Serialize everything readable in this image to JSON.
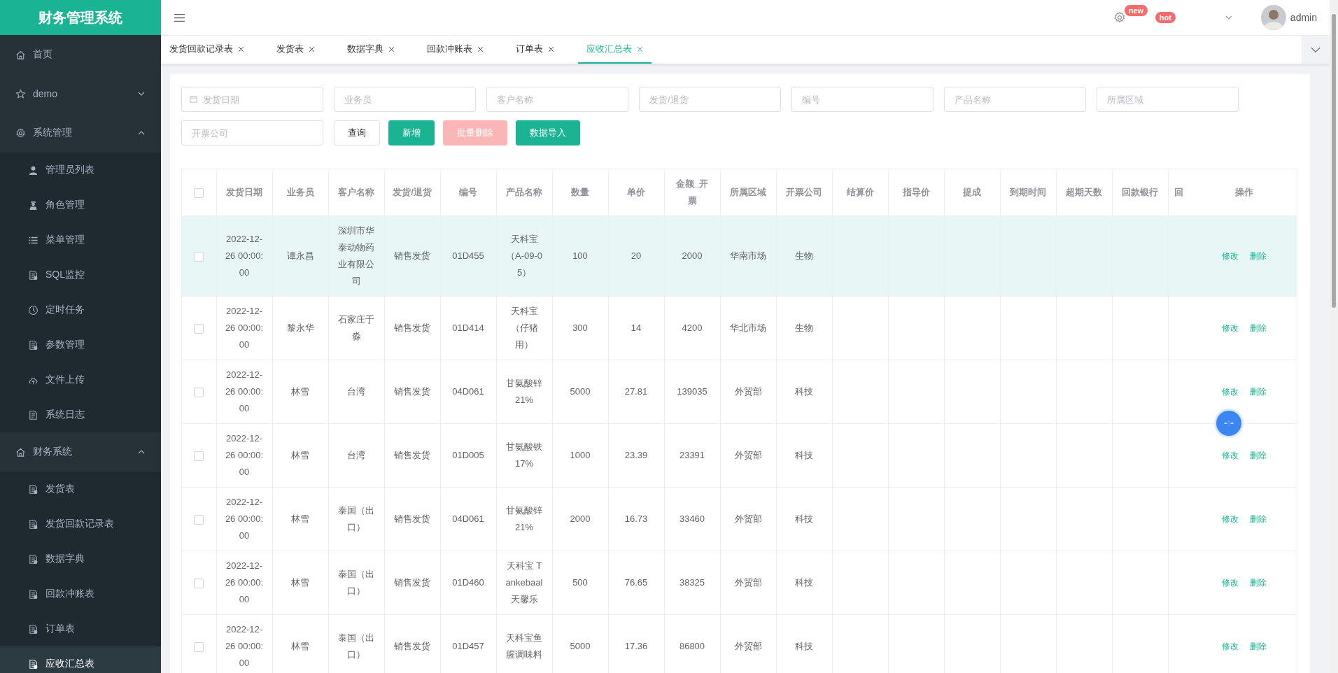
{
  "app": {
    "title": "财务管理系统"
  },
  "sidebar": {
    "items": [
      {
        "label": "首页"
      },
      {
        "label": "demo",
        "expanded": false
      },
      {
        "label": "系统管理",
        "expanded": true,
        "children": [
          {
            "label": "管理员列表",
            "selected": false
          },
          {
            "label": "角色管理",
            "selected": false
          },
          {
            "label": "菜单管理",
            "selected": false
          },
          {
            "label": "SQL监控",
            "selected": false
          },
          {
            "label": "定时任务",
            "selected": false
          },
          {
            "label": "参数管理",
            "selected": false
          },
          {
            "label": "文件上传",
            "selected": false
          },
          {
            "label": "系统日志",
            "selected": false
          }
        ]
      },
      {
        "label": "财务系统",
        "expanded": true,
        "children": [
          {
            "label": "发货表",
            "selected": false
          },
          {
            "label": "发货回款记录表",
            "selected": false
          },
          {
            "label": "数据字典",
            "selected": false
          },
          {
            "label": "回款冲账表",
            "selected": false
          },
          {
            "label": "订单表",
            "selected": false
          },
          {
            "label": "应收汇总表",
            "selected": true
          }
        ]
      }
    ]
  },
  "header": {
    "badges": [
      {
        "label": "new"
      },
      {
        "label": "hot"
      }
    ],
    "user": "admin"
  },
  "tabs": [
    {
      "label": "发货回款记录表",
      "selected": false
    },
    {
      "label": "发货表",
      "selected": false
    },
    {
      "label": "数据字典",
      "selected": false
    },
    {
      "label": "回款冲账表",
      "selected": false
    },
    {
      "label": "订单表",
      "selected": false
    },
    {
      "label": "应收汇总表",
      "selected": true
    }
  ],
  "filters": [
    {
      "kind": "date",
      "placeholder": "发货日期"
    },
    {
      "kind": "text",
      "placeholder": "业务员"
    },
    {
      "kind": "text",
      "placeholder": "客户名称"
    },
    {
      "kind": "text",
      "placeholder": "发货/退货"
    },
    {
      "kind": "text",
      "placeholder": "编号"
    },
    {
      "kind": "text",
      "placeholder": "产品名称"
    },
    {
      "kind": "text",
      "placeholder": "所属区域"
    },
    {
      "kind": "text",
      "placeholder": "开票公司"
    }
  ],
  "buttons": [
    {
      "label": "查询",
      "kind": "default"
    },
    {
      "label": "新增",
      "kind": "primary"
    },
    {
      "label": "批量删除",
      "kind": "disabled"
    },
    {
      "label": "数据导入",
      "kind": "primary"
    }
  ],
  "table": {
    "select_all_checked": false,
    "columns": [
      "发货日期",
      "业务员",
      "客户名称",
      "发货/退货",
      "编号",
      "产品名称",
      "数量",
      "单价",
      "金额_开票",
      "所属区域",
      "开票公司",
      "结算价",
      "指导价",
      "提成",
      "到期时间",
      "超期天数",
      "回款银行",
      "回"
    ],
    "action_column": "操作",
    "rows": [
      {
        "highlighted": true,
        "checked": false,
        "cells": [
          "2022-12-26 00:00:00",
          "谭永昌",
          "深圳市华泰动物药业有限公司",
          "销售发货",
          "01D455",
          "天科宝（A-09-05）",
          "100",
          "20",
          "2000",
          "华南市场",
          "生物"
        ],
        "actions": [
          "修改",
          "删除"
        ]
      },
      {
        "highlighted": false,
        "checked": false,
        "cells": [
          "2022-12-26 00:00:00",
          "黎永华",
          "石家庄于淼",
          "销售发货",
          "01D414",
          "天科宝（仔猪用）",
          "300",
          "14",
          "4200",
          "华北市场",
          "生物"
        ],
        "actions": [
          "修改",
          "删除"
        ]
      },
      {
        "highlighted": false,
        "checked": false,
        "cells": [
          "2022-12-26 00:00:00",
          "林雪",
          "台湾",
          "销售发货",
          "04D061",
          "甘氨酸锌21%",
          "5000",
          "27.81",
          "139035",
          "外贸部",
          "科技"
        ],
        "actions": [
          "修改",
          "删除"
        ]
      },
      {
        "highlighted": false,
        "checked": false,
        "cells": [
          "2022-12-26 00:00:00",
          "林雪",
          "台湾",
          "销售发货",
          "01D005",
          "甘氨酸铁17%",
          "1000",
          "23.39",
          "23391",
          "外贸部",
          "科技"
        ],
        "actions": [
          "修改",
          "删除"
        ]
      },
      {
        "highlighted": false,
        "checked": false,
        "cells": [
          "2022-12-26 00:00:00",
          "林雪",
          "泰国（出口）",
          "销售发货",
          "04D061",
          "甘氨酸锌21%",
          "2000",
          "16.73",
          "33460",
          "外贸部",
          "科技"
        ],
        "actions": [
          "修改",
          "删除"
        ]
      },
      {
        "highlighted": false,
        "checked": false,
        "cells": [
          "2022-12-26 00:00:00",
          "林雪",
          "泰国（出口）",
          "销售发货",
          "01D460",
          "天科宝 Tankebaal天馨乐",
          "500",
          "76.65",
          "38325",
          "外贸部",
          "科技"
        ],
        "actions": [
          "修改",
          "删除"
        ]
      },
      {
        "highlighted": false,
        "checked": false,
        "cells": [
          "2022-12-26 00:00:00",
          "林雪",
          "泰国（出口）",
          "销售发货",
          "01D457",
          "天科宝鱼腥调味料",
          "5000",
          "17.36",
          "86800",
          "外贸部",
          "科技"
        ],
        "actions": [
          "修改",
          "删除"
        ]
      }
    ]
  }
}
